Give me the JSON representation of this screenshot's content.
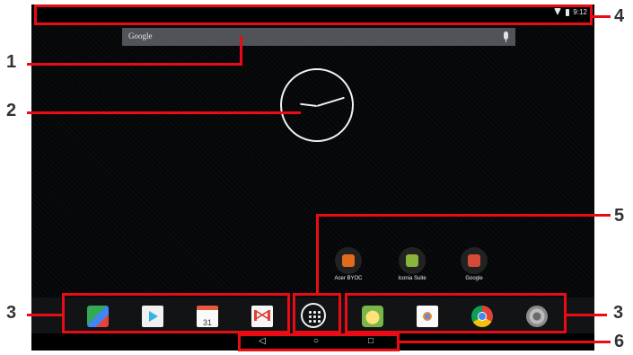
{
  "status_bar": {
    "time": "9:12"
  },
  "search_bar": {
    "label": "Google"
  },
  "shortcuts": [
    {
      "label": "Acer BYOC",
      "color": "#e06b1a"
    },
    {
      "label": "Iconia Suite",
      "color": "#89b53a"
    },
    {
      "label": "Google",
      "color": "#d64a3a"
    }
  ],
  "dock": {
    "left_apps": [
      "maps-icon",
      "play-store-icon",
      "calendar-icon",
      "gmail-icon"
    ],
    "calendar_day": "31",
    "all_apps": "all-apps-icon",
    "right_apps": [
      "gallery-icon",
      "camera-icon",
      "chrome-icon",
      "settings-icon"
    ]
  },
  "nav_bar": {
    "back": "◁",
    "home": "○",
    "recents": "□"
  },
  "callouts": {
    "n1": "1",
    "n2": "2",
    "n3": "3",
    "n4": "4",
    "n5": "5",
    "n6": "6"
  }
}
